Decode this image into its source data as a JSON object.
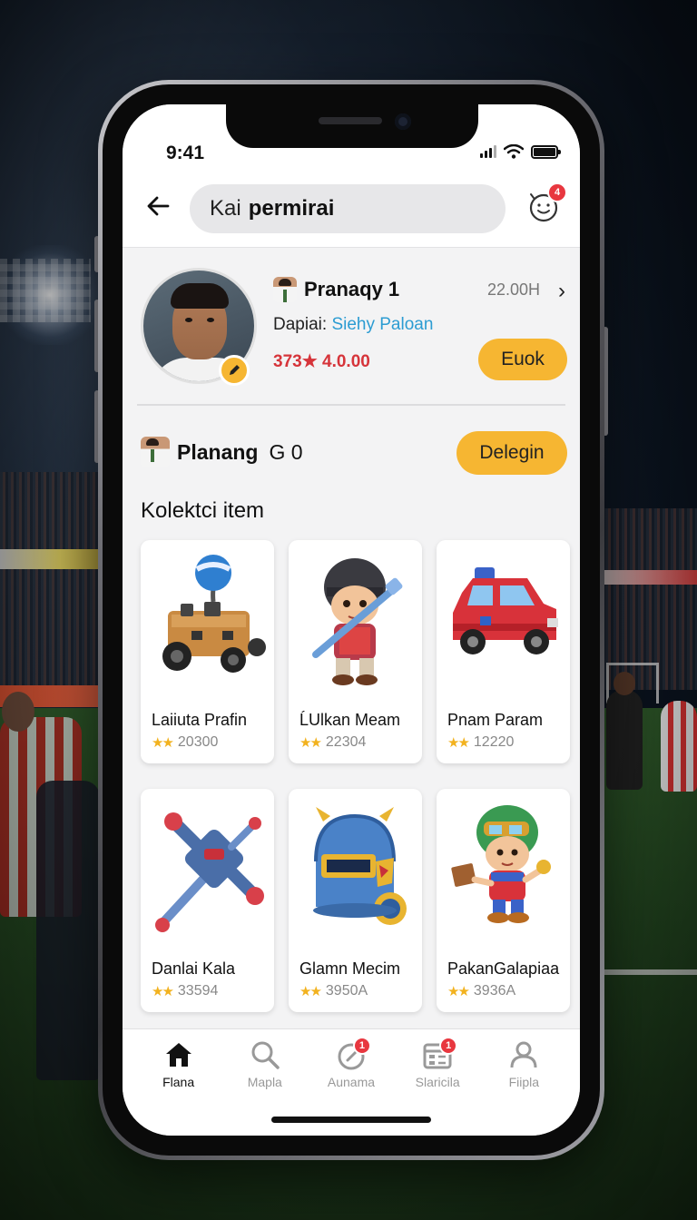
{
  "status": {
    "time": "9:41"
  },
  "header": {
    "search_query_light": "Kai",
    "search_query_bold": "permirai",
    "notification_count": "4"
  },
  "profile": {
    "name": "Pranaqy 1",
    "amount": "22.00Н",
    "dapai_label": "Dapiai:",
    "dapai_link": "Siehy Paloan",
    "stats": "373★ 4.0.00",
    "action_button": "Euok"
  },
  "row2": {
    "title": "Planang",
    "subtitle": "G 0",
    "action_button": "Delegin"
  },
  "section_title": "Kolektci item",
  "items": [
    {
      "title": "Laiiuta Prafin",
      "rating": "20300",
      "icon": "robot-cart-icon"
    },
    {
      "title": "ĹUlkan Meam",
      "rating": "22304",
      "icon": "helmet-warrior-icon"
    },
    {
      "title": "Pnam Param",
      "rating": "12220",
      "icon": "red-car-icon"
    },
    {
      "title": "Danlai Kala",
      "rating": "33594",
      "icon": "hammer-icon"
    },
    {
      "title": "Glamn Mecim",
      "rating": "3950A",
      "icon": "knight-helmet-icon"
    },
    {
      "title": "PakanGalapiaa",
      "rating": "3936A",
      "icon": "green-helmet-kid-icon"
    }
  ],
  "tabbar": [
    {
      "label": "Flana",
      "icon": "home-icon",
      "active": true
    },
    {
      "label": "Mapla",
      "icon": "search-icon"
    },
    {
      "label": "Aunama",
      "icon": "compass-icon",
      "badge": "1"
    },
    {
      "label": "Slaricila",
      "icon": "calendar-icon",
      "badge": "1"
    },
    {
      "label": "Fiipla",
      "icon": "person-icon"
    }
  ],
  "colors": {
    "accent": "#f6b632",
    "badge": "#e8373f",
    "link": "#2c9cd2",
    "stats": "#d6343a"
  }
}
